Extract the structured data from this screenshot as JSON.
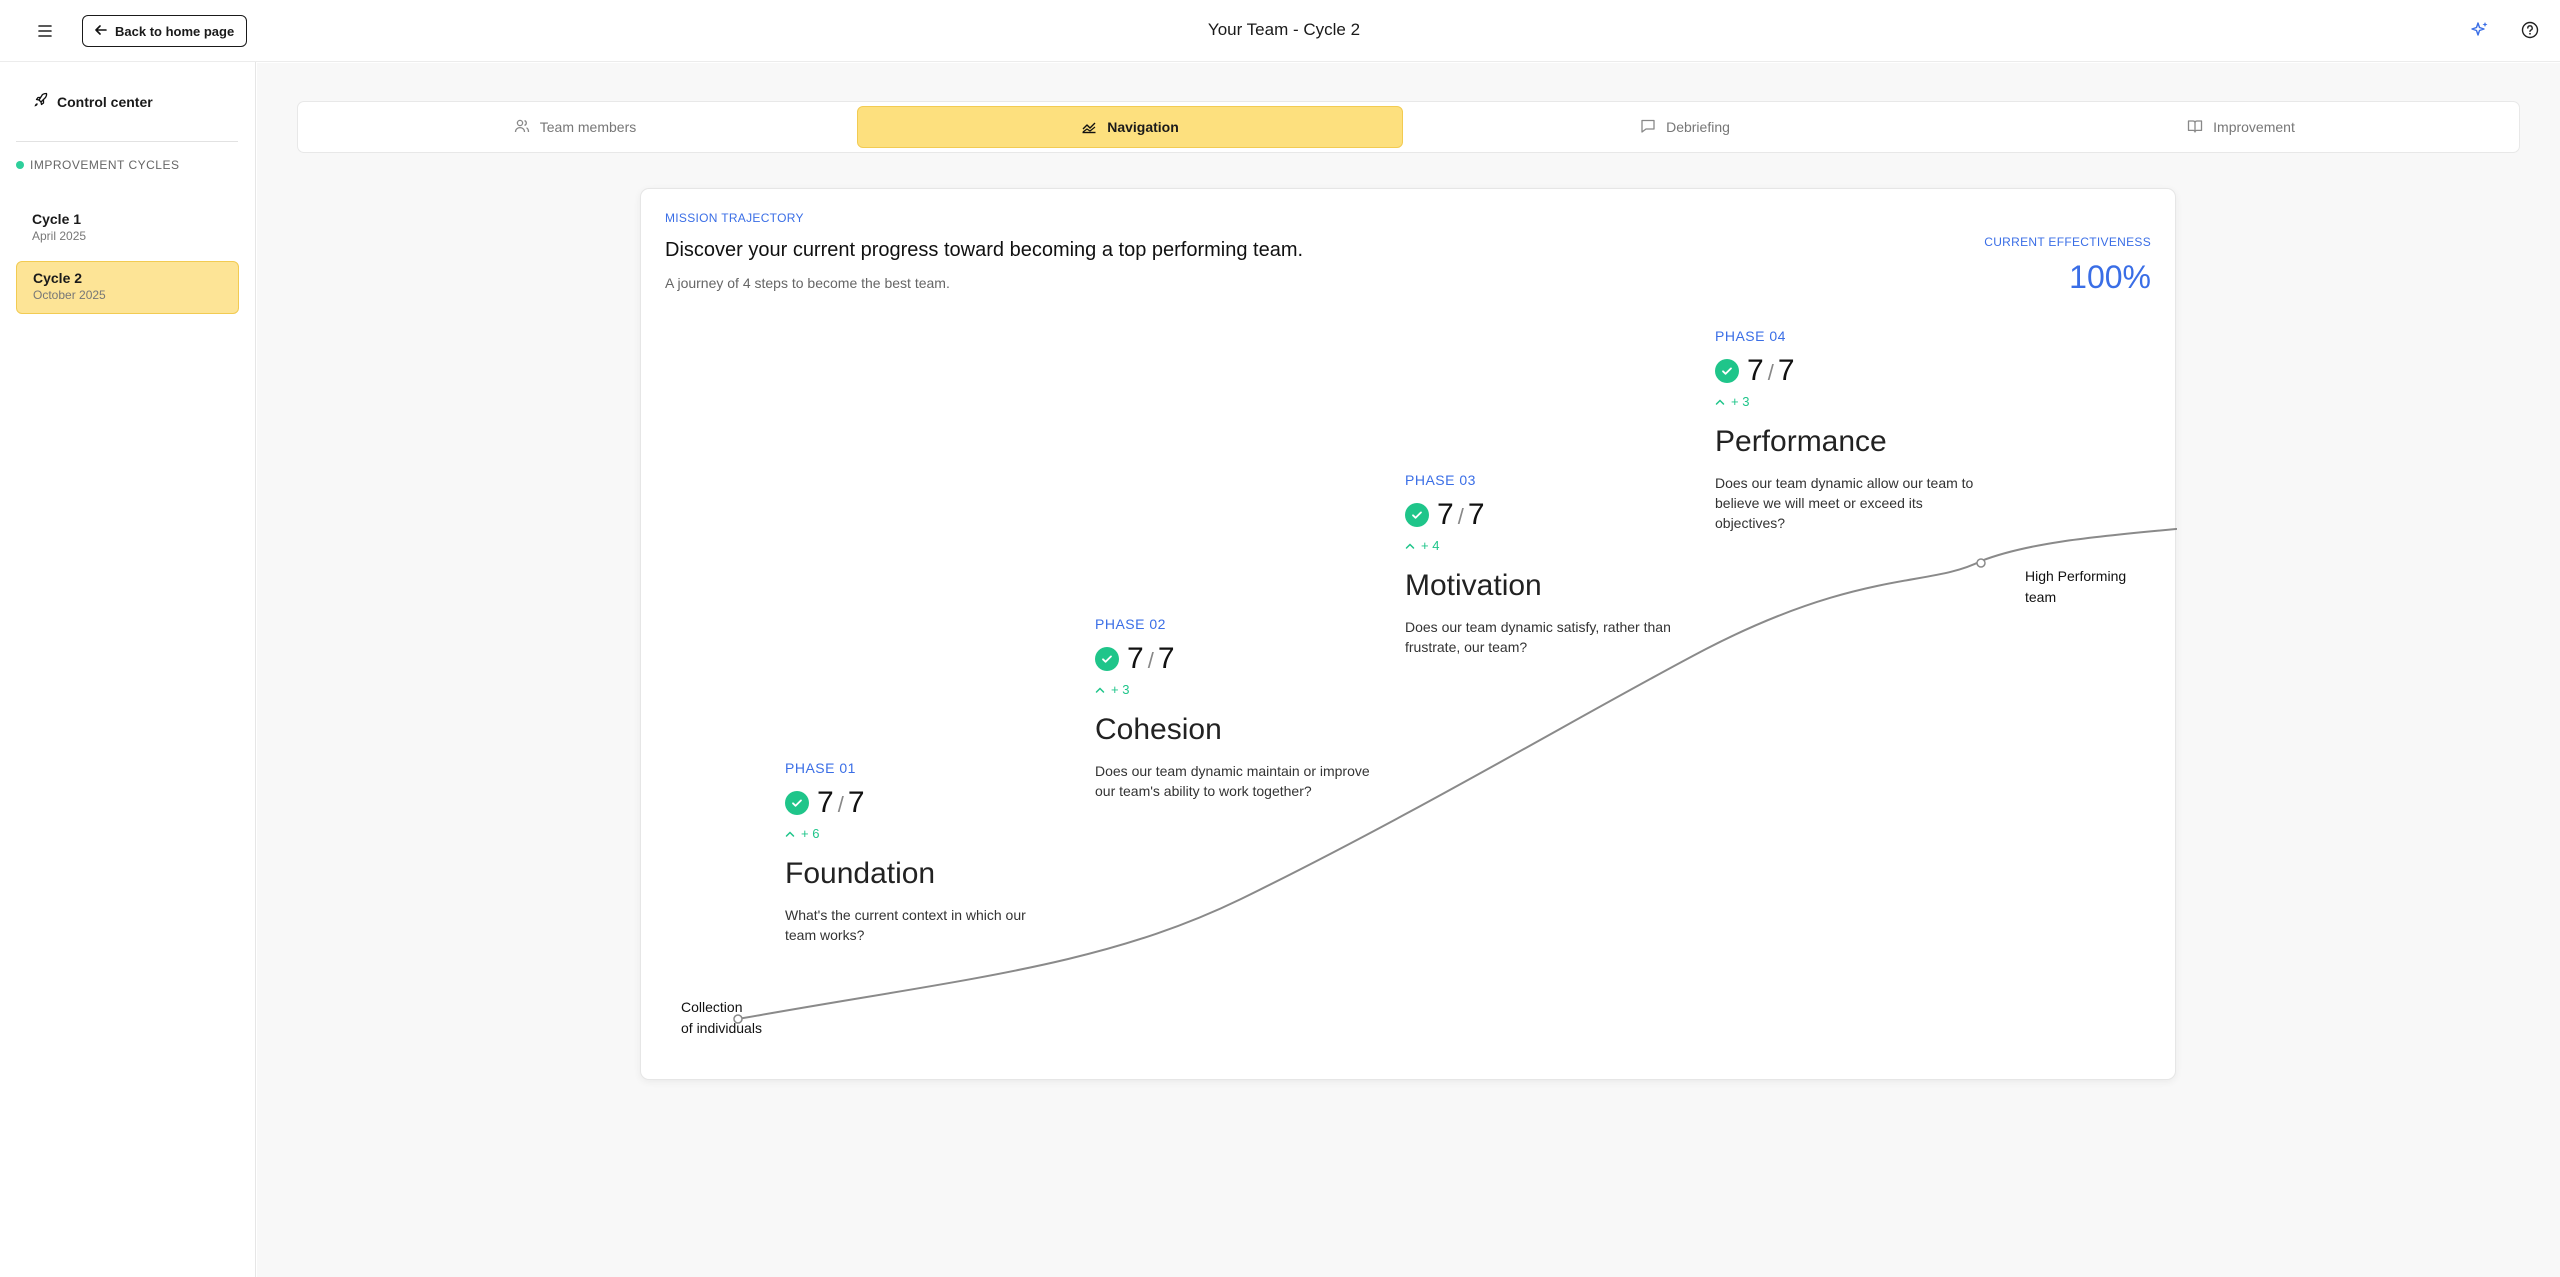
{
  "header": {
    "back_label": "Back to home page",
    "title": "Your Team - Cycle 2",
    "icons": [
      "menu-icon",
      "arrow-left-icon",
      "sparkles-icon",
      "help-icon"
    ]
  },
  "sidebar": {
    "control_center": "Control center",
    "section_label": "IMPROVEMENT CYCLES",
    "cycles": [
      {
        "name": "Cycle 1",
        "date": "April 2025"
      },
      {
        "name": "Cycle 2",
        "date": "October 2025"
      }
    ]
  },
  "tabs": [
    {
      "label": "Team members",
      "icon": "users-icon"
    },
    {
      "label": "Navigation",
      "icon": "trending-chart-icon"
    },
    {
      "label": "Debriefing",
      "icon": "message-icon"
    },
    {
      "label": "Improvement",
      "icon": "book-open-icon"
    }
  ],
  "mission": {
    "kicker": "MISSION TRAJECTORY",
    "headline": "Discover your current progress toward becoming a top performing team.",
    "subhead": "A journey of 4 steps to become the best team.",
    "effectiveness_label": "CURRENT EFFECTIVENESS",
    "effectiveness_value": "100%",
    "start_label_1": "Collection",
    "start_label_2": "of individuals",
    "end_label_1": "High Performing",
    "end_label_2": "team"
  },
  "phases": [
    {
      "label": "PHASE 01",
      "score": "7",
      "total": "7",
      "delta": "+ 6",
      "title": "Foundation",
      "desc": "What's the current context in which our team works?"
    },
    {
      "label": "PHASE 02",
      "score": "7",
      "total": "7",
      "delta": "+ 3",
      "title": "Cohesion",
      "desc": "Does our team dynamic maintain or improve our team's ability to work together?"
    },
    {
      "label": "PHASE 03",
      "score": "7",
      "total": "7",
      "delta": "+ 4",
      "title": "Motivation",
      "desc": "Does our team dynamic satisfy, rather than frustrate, our team?"
    },
    {
      "label": "PHASE 04",
      "score": "7",
      "total": "7",
      "delta": "+ 3",
      "title": "Performance",
      "desc": "Does our team dynamic allow our team to believe we will meet or exceed its objectives?"
    }
  ],
  "colors": {
    "accent": "#3a6ee6",
    "success": "#1fc58a",
    "highlight": "#fde07e"
  }
}
